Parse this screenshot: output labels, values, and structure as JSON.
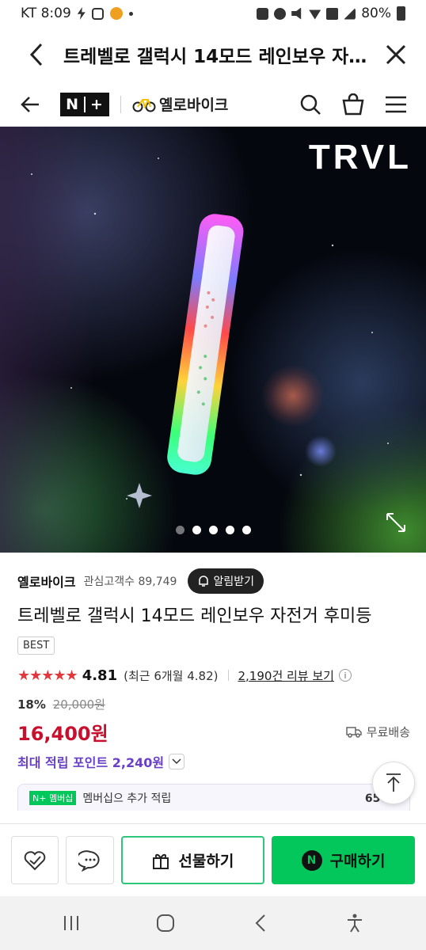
{
  "status_bar": {
    "carrier_time": "KT 8:09",
    "battery": "80%"
  },
  "browser": {
    "title": "트레벨로 갤럭시 14모드 레인보우 자..."
  },
  "store": {
    "badge_n": "N",
    "badge_plus": "+",
    "brand_logo": "옐로바이크"
  },
  "hero": {
    "watermark": "TRVL",
    "slide_count": 5,
    "active_slide": 1
  },
  "product": {
    "brand": "옐로바이크",
    "interest_label": "관심고객수 89,749",
    "alarm_label": "알림받기",
    "name": "트레벨로 갤럭시 14모드 레인보우 자전거 후미등",
    "badge": "BEST",
    "stars": "★★★★★",
    "rating": "4.81",
    "recent_rating": "(최근 6개월 4.82)",
    "reviews": "2,190건 리뷰 보기",
    "discount_rate": "18%",
    "original_price": "20,000원",
    "price": "16,400원",
    "shipping": "무료배송",
    "points": "최대 적립 포인트 2,240원",
    "member_tag": "N+ 멤버십",
    "member_text": "멤버십으 추가 적립",
    "member_amount": "656원"
  },
  "actions": {
    "gift_label": "선물하기",
    "buy_label": "구매하기",
    "buy_badge": "N"
  },
  "colors": {
    "price_red": "#c8102e",
    "points_purple": "#6a3fc8",
    "naver_green": "#03c75a",
    "star_red": "#e0383c"
  }
}
